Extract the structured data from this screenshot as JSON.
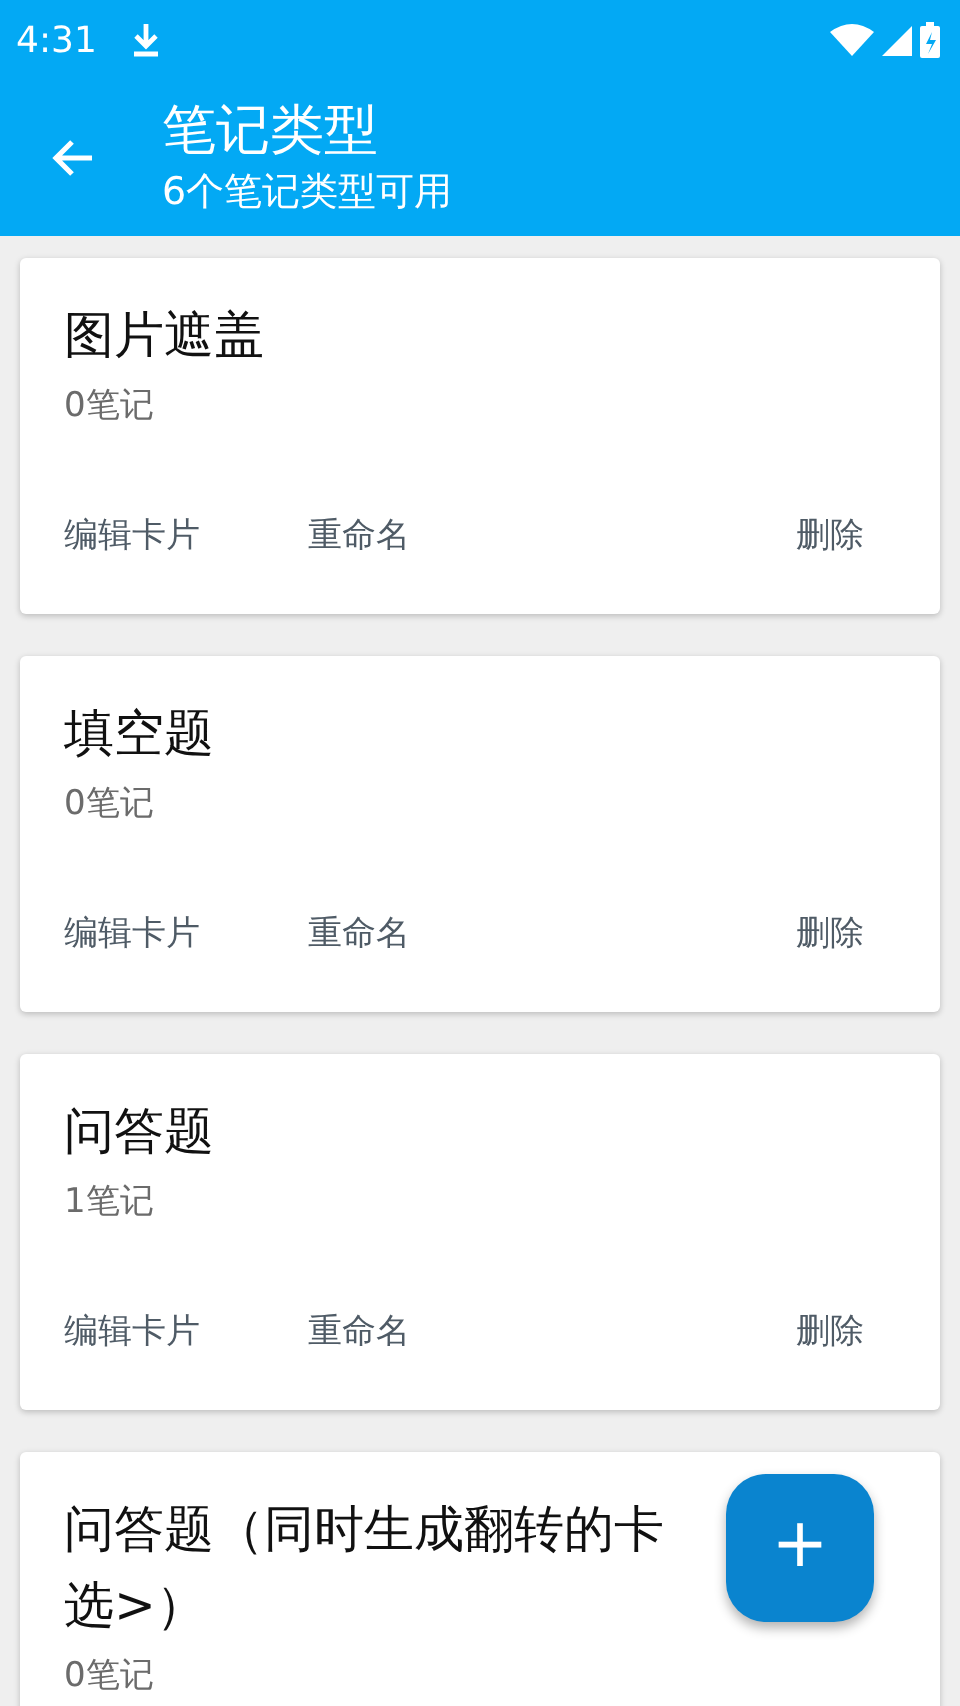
{
  "status_bar": {
    "time": "4:31"
  },
  "app_bar": {
    "title": "笔记类型",
    "subtitle": "6个笔记类型可用"
  },
  "note_types": [
    {
      "title_lines": [
        "图片遮盖"
      ],
      "count": "0笔记",
      "actions": [
        "编辑卡片",
        "重命名",
        "删除"
      ]
    },
    {
      "title_lines": [
        "填空题"
      ],
      "count": "0笔记",
      "actions": [
        "编辑卡片",
        "重命名",
        "删除"
      ]
    },
    {
      "title_lines": [
        "问答题"
      ],
      "count": "1笔记",
      "actions": [
        "编辑卡片",
        "重命名",
        "删除"
      ]
    },
    {
      "title_lines": [
        "问答题（同时生成翻转的卡",
        "选>）"
      ],
      "count": "0笔记"
    }
  ],
  "fab": {
    "label": "+"
  }
}
